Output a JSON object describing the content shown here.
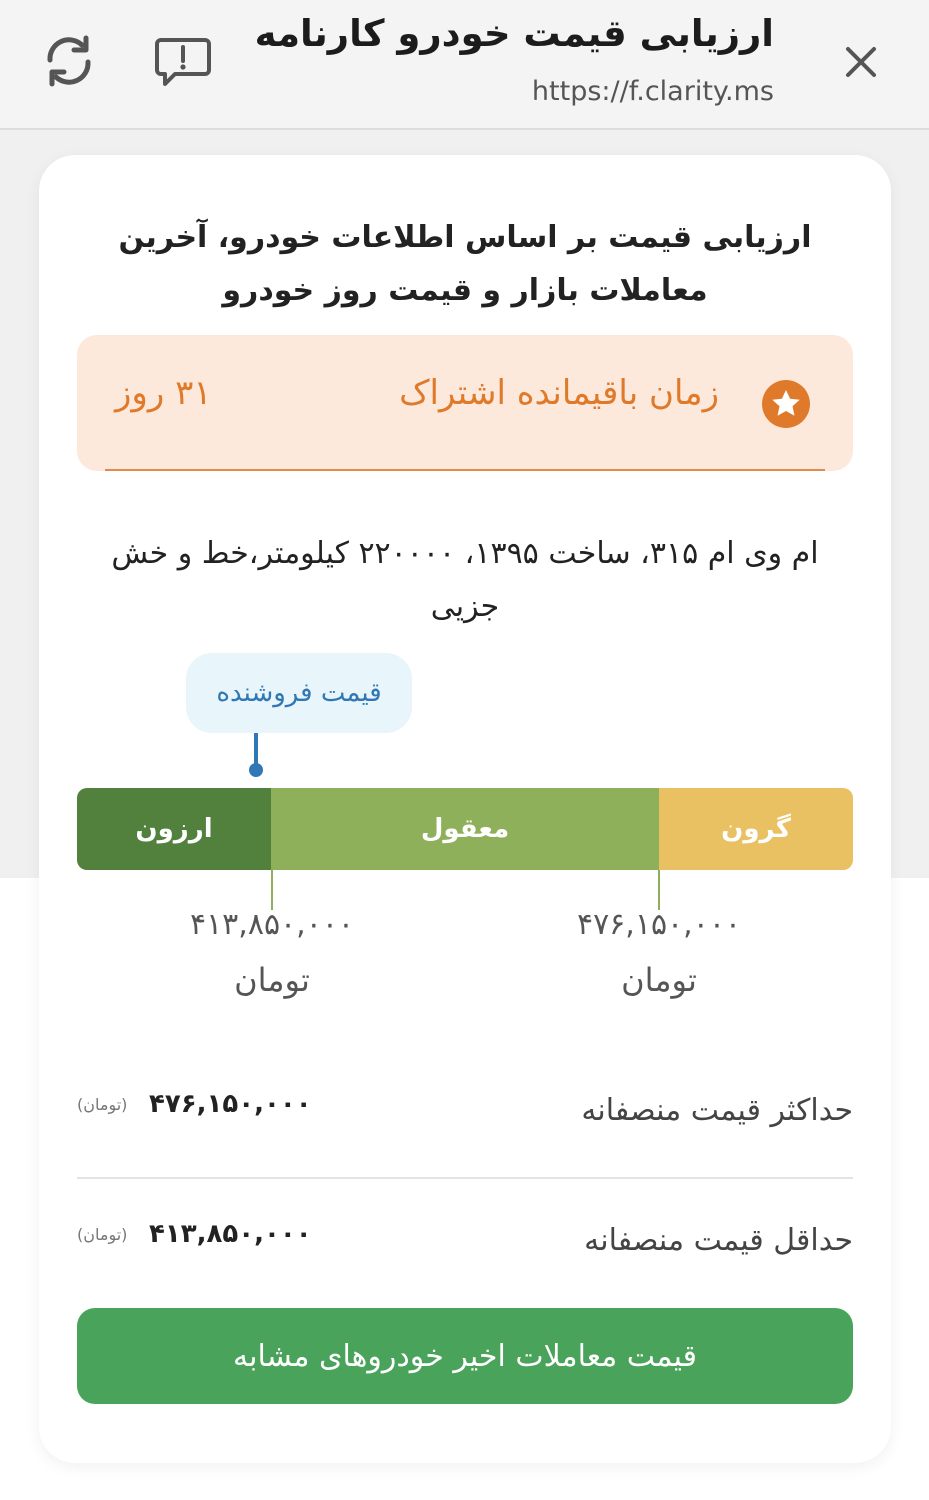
{
  "header": {
    "title": "ارزیابی قیمت خودرو کارنامه",
    "url": "https://f.clarity.ms"
  },
  "card": {
    "intro": "ارزیابی قیمت بر اساس اطلاعات خودرو، آخرین معاملات بازار و قیمت روز خودرو",
    "subscription": {
      "label": "زمان باقیمانده اشتراک",
      "value": "۳۱ روز"
    },
    "car_description": "ام وی ام ۳۱۵، ساخت ۱۳۹۵، ۲۲۰۰۰۰ کیلومتر،خط و خش جزیی",
    "seller_tag": "قیمت فروشنده",
    "price_bar": {
      "segments": [
        "ارزون",
        "معقول",
        "گرون"
      ],
      "boundaries": [
        {
          "amount": "۴۱۳,۸۵۰,۰۰۰",
          "unit": "تومان"
        },
        {
          "amount": "۴۷۶,۱۵۰,۰۰۰",
          "unit": "تومان"
        }
      ]
    },
    "stats": [
      {
        "label": "حداکثر قیمت منصفانه",
        "amount": "۴۷۶,۱۵۰,۰۰۰",
        "unit": "(تومان)"
      },
      {
        "label": "حداقل قیمت منصفانه",
        "amount": "۴۱۳,۸۵۰,۰۰۰",
        "unit": "(تومان)"
      }
    ],
    "cta_label": "قیمت معاملات اخیر خودروهای مشابه"
  },
  "colors": {
    "cheap": "#52803d",
    "fair": "#8fb05b",
    "expensive": "#e9c162",
    "accent_orange": "#e07a2b",
    "seller_blue": "#3277b5",
    "cta_green": "#4aa35a"
  }
}
